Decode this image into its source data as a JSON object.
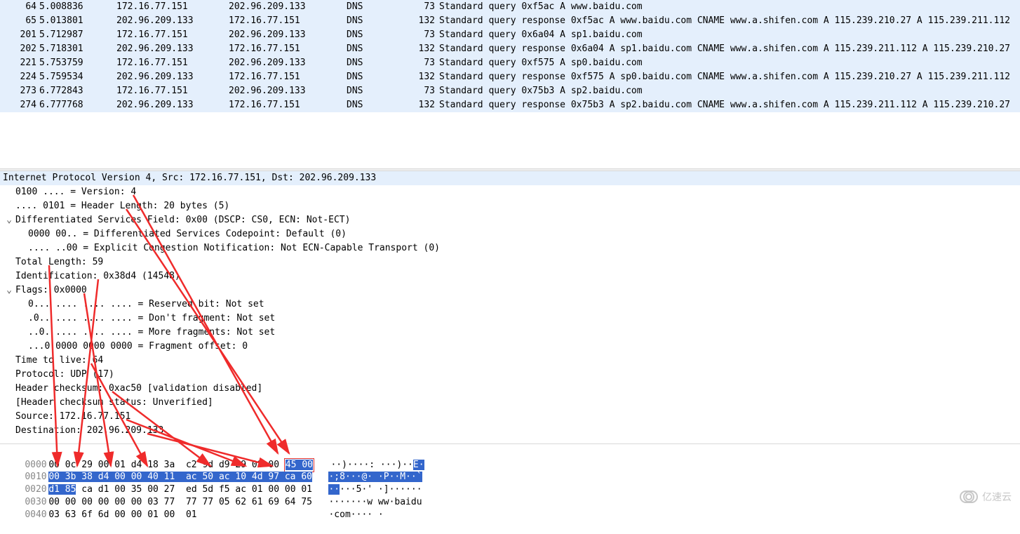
{
  "packets": [
    {
      "no": "64",
      "time": "5.008836",
      "src": "172.16.77.151",
      "dst": "202.96.209.133",
      "proto": "DNS",
      "len": "73",
      "info": "Standard query 0xf5ac A www.baidu.com"
    },
    {
      "no": "65",
      "time": "5.013801",
      "src": "202.96.209.133",
      "dst": "172.16.77.151",
      "proto": "DNS",
      "len": "132",
      "info": "Standard query response 0xf5ac A www.baidu.com CNAME www.a.shifen.com A 115.239.210.27 A 115.239.211.112"
    },
    {
      "no": "201",
      "time": "5.712987",
      "src": "172.16.77.151",
      "dst": "202.96.209.133",
      "proto": "DNS",
      "len": "73",
      "info": "Standard query 0x6a04 A sp1.baidu.com"
    },
    {
      "no": "202",
      "time": "5.718301",
      "src": "202.96.209.133",
      "dst": "172.16.77.151",
      "proto": "DNS",
      "len": "132",
      "info": "Standard query response 0x6a04 A sp1.baidu.com CNAME www.a.shifen.com A 115.239.211.112 A 115.239.210.27"
    },
    {
      "no": "221",
      "time": "5.753759",
      "src": "172.16.77.151",
      "dst": "202.96.209.133",
      "proto": "DNS",
      "len": "73",
      "info": "Standard query 0xf575 A sp0.baidu.com"
    },
    {
      "no": "224",
      "time": "5.759534",
      "src": "202.96.209.133",
      "dst": "172.16.77.151",
      "proto": "DNS",
      "len": "132",
      "info": "Standard query response 0xf575 A sp0.baidu.com CNAME www.a.shifen.com A 115.239.210.27 A 115.239.211.112"
    },
    {
      "no": "273",
      "time": "6.772843",
      "src": "172.16.77.151",
      "dst": "202.96.209.133",
      "proto": "DNS",
      "len": "73",
      "info": "Standard query 0x75b3 A sp2.baidu.com"
    },
    {
      "no": "274",
      "time": "6.777768",
      "src": "202.96.209.133",
      "dst": "172.16.77.151",
      "proto": "DNS",
      "len": "132",
      "info": "Standard query response 0x75b3 A sp2.baidu.com CNAME www.a.shifen.com A 115.239.211.112 A 115.239.210.27"
    }
  ],
  "detail_header": "Internet Protocol Version 4, Src: 172.16.77.151, Dst: 202.96.209.133",
  "details": [
    {
      "cls": "d1",
      "exp": "",
      "txt": "0100 .... = Version: 4"
    },
    {
      "cls": "d1",
      "exp": "",
      "txt": ".... 0101 = Header Length: 20 bytes (5)"
    },
    {
      "cls": "d1",
      "exp": "v",
      "txt": "Differentiated Services Field: 0x00 (DSCP: CS0, ECN: Not-ECT)"
    },
    {
      "cls": "d2",
      "exp": "",
      "txt": "0000 00.. = Differentiated Services Codepoint: Default (0)"
    },
    {
      "cls": "d2",
      "exp": "",
      "txt": ".... ..00 = Explicit Congestion Notification: Not ECN-Capable Transport (0)"
    },
    {
      "cls": "d1",
      "exp": "",
      "txt": "Total Length: 59"
    },
    {
      "cls": "d1",
      "exp": "",
      "txt": "Identification: 0x38d4 (14548)"
    },
    {
      "cls": "d1",
      "exp": "v",
      "txt": "Flags: 0x0000"
    },
    {
      "cls": "d2",
      "exp": "",
      "txt": "0... .... .... .... = Reserved bit: Not set"
    },
    {
      "cls": "d2",
      "exp": "",
      "txt": ".0.. .... .... .... = Don't fragment: Not set"
    },
    {
      "cls": "d2",
      "exp": "",
      "txt": "..0. .... .... .... = More fragments: Not set"
    },
    {
      "cls": "d2",
      "exp": "",
      "txt": "...0 0000 0000 0000 = Fragment offset: 0"
    },
    {
      "cls": "d1",
      "exp": "",
      "txt": "Time to live: 64"
    },
    {
      "cls": "d1",
      "exp": "",
      "txt": "Protocol: UDP (17)"
    },
    {
      "cls": "d1",
      "exp": "",
      "txt": "Header checksum: 0xac50 [validation disabled]"
    },
    {
      "cls": "d1",
      "exp": "",
      "txt": "[Header checksum status: Unverified]"
    },
    {
      "cls": "d1",
      "exp": "",
      "txt": "Source: 172.16.77.151"
    },
    {
      "cls": "d1",
      "exp": "",
      "txt": "Destination: 202.96.209.133"
    }
  ],
  "bytes": {
    "r0": {
      "off": "0000",
      "b0": "00 0c 29 00 01 d4 18 3a  c2 9d d9 29 08 00 ",
      "h0": "45 00",
      "a0": "··)····: ···)··",
      "ah": "E·"
    },
    "r1": {
      "off": "0010",
      "h1": "00 3b 38 d4 00 00 40 11  ac 50 ac 10 4d 97 ca 60",
      "a1": "·;8···@· ·P··M··`"
    },
    "r2": {
      "off": "0020",
      "h2": "d1 85",
      "b2": " ca d1 00 35 00 27  ed 5d f5 ac 01 00 00 01",
      "ah2": "··",
      "a2": "···5·' ·]······"
    },
    "r3": {
      "off": "0030",
      "b3": "00 00 00 00 00 00 03 77  77 77 05 62 61 69 64 75",
      "a3": "·······w ww·baidu"
    },
    "r4": {
      "off": "0040",
      "b4": "03 63 6f 6d 00 00 01 00  01",
      "a4": "·com···· ·"
    }
  },
  "watermark": "亿速云"
}
